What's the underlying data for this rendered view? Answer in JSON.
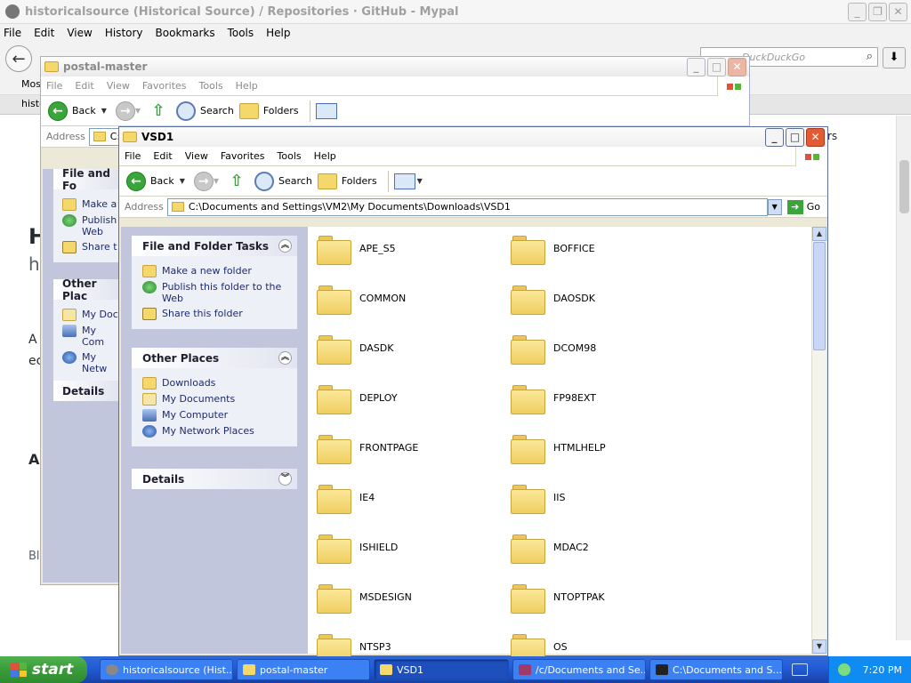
{
  "browser": {
    "title": "historicalsource (Historical Source) / Repositories · GitHub - Mypal",
    "menu": [
      "File",
      "Edit",
      "View",
      "History",
      "Bookmarks",
      "Tools",
      "Help"
    ],
    "search_placeholder": "DuckDuckGo",
    "bookmark_label": "Most",
    "tab_label": "histo",
    "page_fragments": {
      "heading": "H",
      "sub": "h",
      "a": "A",
      "ec": "ec",
      "a2": "A",
      "bl": "Bl",
      "rs": "rs"
    }
  },
  "postal": {
    "title": "postal-master",
    "menu": [
      "File",
      "Edit",
      "View",
      "Favorites",
      "Tools",
      "Help"
    ],
    "toolbar": {
      "back": "Back",
      "search": "Search",
      "folders": "Folders"
    },
    "address_label": "Address",
    "address_value": "C:\\",
    "tasks_title": "File and Fo",
    "tasks": [
      "Make a",
      "Publish",
      "Web",
      "Share t"
    ],
    "places_title": "Other Plac",
    "places": [
      "My Doc",
      "My Com",
      "My Netw"
    ],
    "details_title": "Details"
  },
  "vsd1": {
    "title": "VSD1",
    "menu": [
      "File",
      "Edit",
      "View",
      "Favorites",
      "Tools",
      "Help"
    ],
    "toolbar": {
      "back": "Back",
      "search": "Search",
      "folders": "Folders"
    },
    "address_label": "Address",
    "address_value": "C:\\Documents and Settings\\VM2\\My Documents\\Downloads\\VSD1",
    "go_label": "Go",
    "tasks_title": "File and Folder Tasks",
    "tasks": [
      "Make a new folder",
      "Publish this folder to the",
      "Web",
      "Share this folder"
    ],
    "places_title": "Other Places",
    "places": [
      "Downloads",
      "My Documents",
      "My Computer",
      "My Network Places"
    ],
    "details_title": "Details",
    "folders": [
      "APE_S5",
      "BOFFICE",
      "COMMON",
      "DAOSDK",
      "DASDK",
      "DCOM98",
      "DEPLOY",
      "FP98EXT",
      "FRONTPAGE",
      "HTMLHELP",
      "IE4",
      "IIS",
      "ISHIELD",
      "MDAC2",
      "MSDESIGN",
      "NTOPTPAK",
      "NTSP3",
      "OS"
    ]
  },
  "taskbar": {
    "start_label": "start",
    "tasks": [
      "historicalsource (Hist...",
      "postal-master",
      "VSD1",
      "/c/Documents and Se...",
      "C:\\Documents and S..."
    ],
    "clock": "7:20 PM"
  },
  "colors": {
    "xp_blue_border": "#0831d9",
    "taskbar_blue": "#245dd9",
    "start_green": "#3a9b3a",
    "folder_yellow": "#f5d86b",
    "close_red": "#e45a33"
  }
}
